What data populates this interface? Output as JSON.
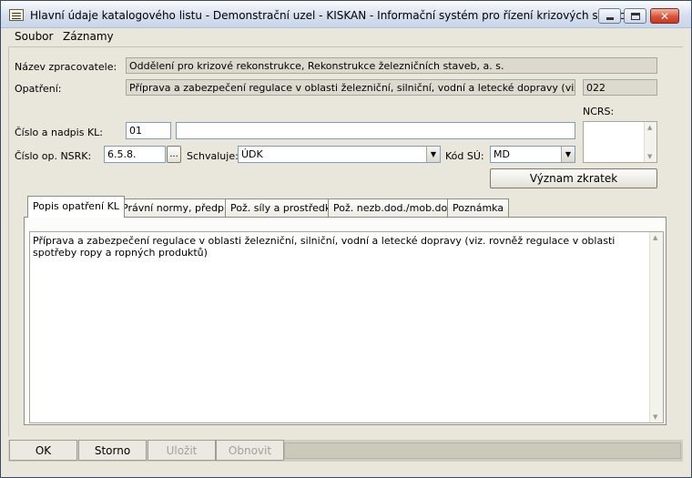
{
  "window": {
    "title": "Hlavní údaje katalogového listu - Demonstrační uzel - KISKAN - Informační systém pro řízení krizových situací",
    "close_glyph": "✕"
  },
  "menu": {
    "items": [
      "Soubor",
      "Záznamy"
    ]
  },
  "form": {
    "processor_label": "Název zpracovatele:",
    "processor_value": "Oddělení pro krizové rekonstrukce, Rekonstrukce železničních staveb, a. s.",
    "measure_label": "Opatření:",
    "measure_value": "Příprava a zabezpečení regulace v oblasti železniční, silniční, vodní a letecké dopravy (viz. rovněž regulace v oblasti spotřeby ropy a ropných produktů)",
    "measure_code": "022",
    "kl_label": "Číslo a nadpis KL:",
    "kl_number": "01",
    "kl_title": "",
    "ncrs_label": "NCRS:",
    "nsrk_label": "Číslo op. NSRK:",
    "nsrk_value": "6.5.8.",
    "browse_label": "...",
    "approves_label": "Schvaluje:",
    "approves_value": "ÚDK",
    "su_label": "Kód SÚ:",
    "su_value": "MD",
    "abbrev_button": "Význam zkratek"
  },
  "tabs": [
    {
      "label": "Popis opatření KL",
      "active": true
    },
    {
      "label": "Právní normy, předpisy",
      "active": false
    },
    {
      "label": "Pož. síly a prostředky",
      "active": false
    },
    {
      "label": "Pož. nezb.dod./mob.dod.",
      "active": false
    },
    {
      "label": "Poznámka",
      "active": false
    }
  ],
  "description": {
    "text": "Příprava a zabezpečení regulace v oblasti železniční, silniční, vodní a letecké dopravy (viz. rovněž regulace v oblasti spotřeby ropy a ropných produktů)"
  },
  "buttons": {
    "ok": "OK",
    "storno": "Storno",
    "ulozit": "Uložit",
    "obnovit": "Obnovit"
  },
  "icons": {
    "app": "form-icon",
    "scroll_up": "▲",
    "scroll_down": "▼",
    "combo_arrow": "▼"
  }
}
